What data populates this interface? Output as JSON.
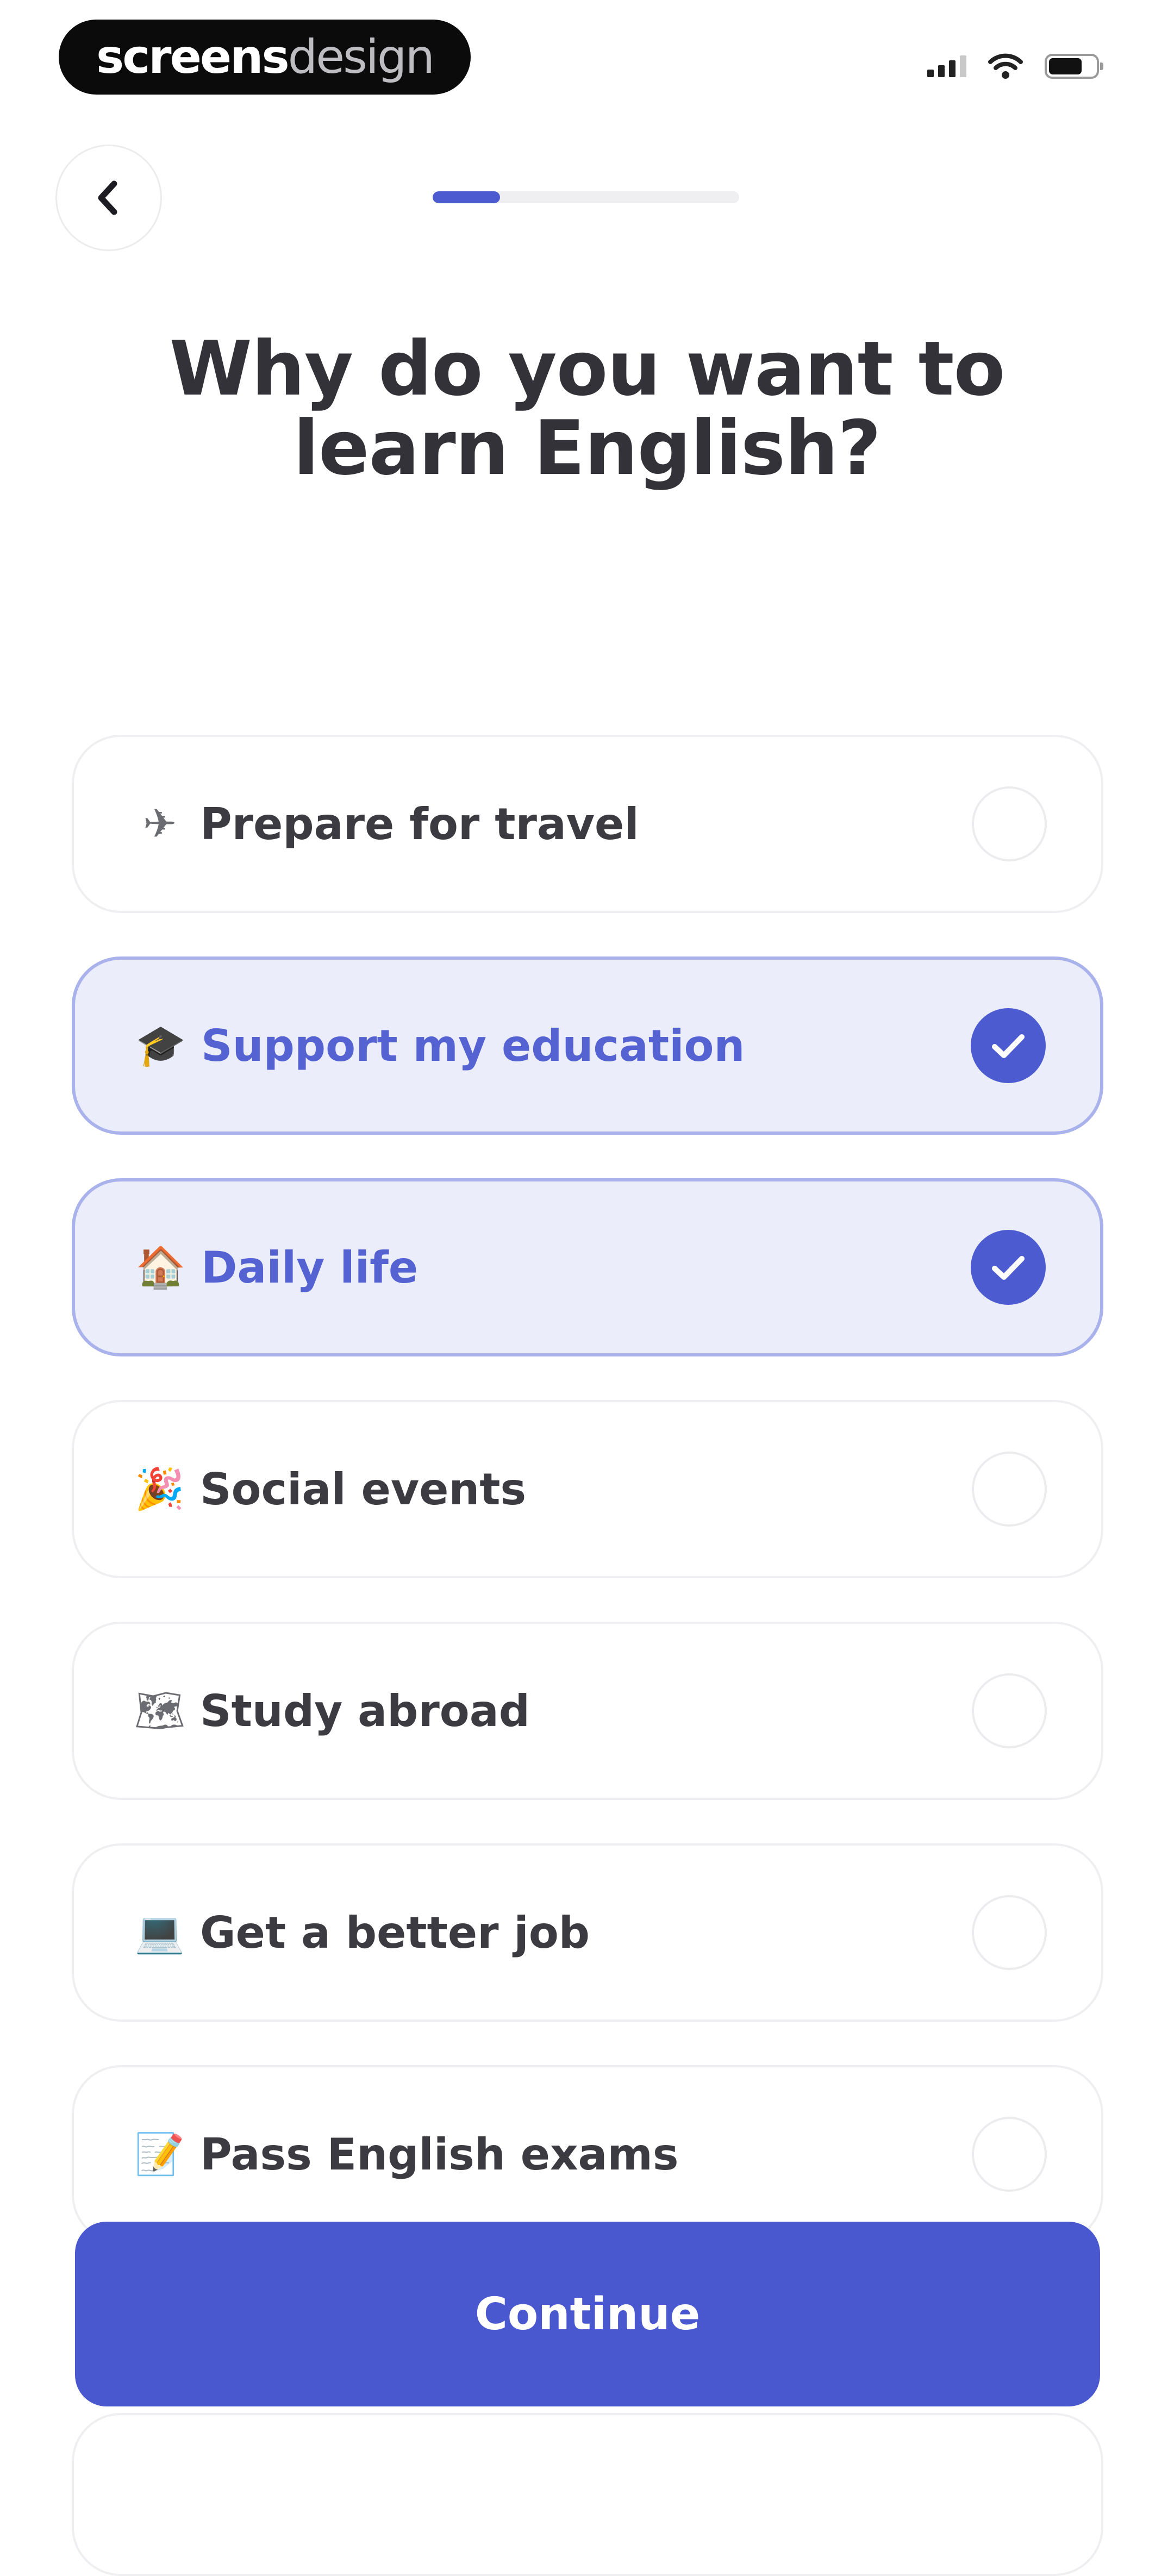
{
  "status_bar": {
    "brand_bold": "screens",
    "brand_light": "design"
  },
  "nav": {
    "back_icon": "chevron-left-icon",
    "progress": 0.22
  },
  "title": "Why do you want to learn English?",
  "options": [
    {
      "emoji": "✈",
      "label": "Prepare for travel",
      "selected": false
    },
    {
      "emoji": "🎓",
      "label": "Support my education",
      "selected": true
    },
    {
      "emoji": "🏠",
      "label": "Daily life",
      "selected": true
    },
    {
      "emoji": "🎉",
      "label": "Social events",
      "selected": false
    },
    {
      "emoji": "🗺",
      "label": "Study abroad",
      "selected": false
    },
    {
      "emoji": "💻",
      "label": "Get a better job",
      "selected": false
    },
    {
      "emoji": "📝",
      "label": "Pass English exams",
      "selected": false
    }
  ],
  "continue_label": "Continue",
  "colors": {
    "accent": "#4a58cf",
    "selected_bg": "#ebedfb",
    "selected_border": "#aab2ec",
    "selected_text": "#5563d2"
  }
}
